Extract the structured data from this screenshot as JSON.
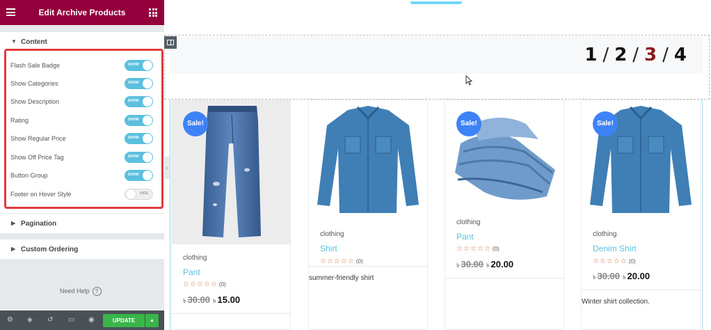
{
  "panel": {
    "title": "Edit Archive Products",
    "content_section": "Content",
    "controls": [
      {
        "label": "Flash Sale Badge",
        "state": "SHOW",
        "on": true
      },
      {
        "label": "Show Categories",
        "state": "SHOW",
        "on": true
      },
      {
        "label": "Show Description",
        "state": "SHOW",
        "on": true
      },
      {
        "label": "Rating",
        "state": "SHOW",
        "on": true
      },
      {
        "label": "Show Regular Price",
        "state": "SHOW",
        "on": true
      },
      {
        "label": "Show Off Price Tag",
        "state": "SHOW",
        "on": true
      },
      {
        "label": "Button Group",
        "state": "SHOW",
        "on": true
      },
      {
        "label": "Footer on Hover Style",
        "state": "HIDE",
        "on": false
      }
    ],
    "pagination_section": "Pagination",
    "ordering_section": "Custom Ordering",
    "need_help": "Need Help",
    "help_glyph": "?",
    "update_label": "UPDATE"
  },
  "pager": {
    "pages": [
      "1",
      "2",
      "3",
      "4"
    ],
    "separator": "/",
    "current": "3"
  },
  "products": [
    {
      "sale": "Sale!",
      "category": "clothing",
      "title": "Pant",
      "rating_count": "(0)",
      "currency": "৳",
      "old_price": "30.00",
      "new_price": "15.00",
      "description": ""
    },
    {
      "sale": "",
      "category": "clothing",
      "title": "Shirt",
      "rating_count": "(0)",
      "currency": "",
      "old_price": "",
      "new_price": "",
      "description": "summer-friendly shirt"
    },
    {
      "sale": "Sale!",
      "category": "clothing",
      "title": "Pant",
      "rating_count": "(0)",
      "currency": "৳",
      "old_price": "30.00",
      "new_price": "20.00",
      "description": ""
    },
    {
      "sale": "Sale!",
      "category": "clothing",
      "title": "Denim Shirt",
      "rating_count": "(0)",
      "currency": "৳",
      "old_price": "30.00",
      "new_price": "20.00",
      "description": "Winter shirt collection."
    }
  ],
  "stars": "☆☆☆☆☆",
  "colors": {
    "header": "#93003c",
    "toggle_on": "#5bc0de",
    "highlight_border": "#e03a3e",
    "sale_badge": "#3e82f7",
    "update_button": "#39b54a"
  },
  "icons": {
    "menu": "hamburger-icon",
    "apps": "grid-icon",
    "footer": [
      "settings-icon",
      "layers-icon",
      "history-icon",
      "responsive-icon",
      "preview-icon"
    ]
  }
}
